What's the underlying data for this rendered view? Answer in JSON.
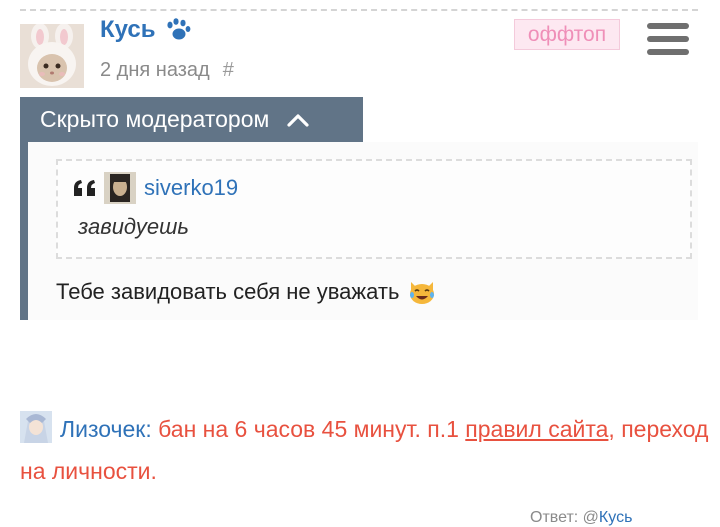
{
  "post": {
    "author": "Кусь",
    "timestamp": "2 дня назад",
    "permalink": "#",
    "tag": "оффтоп",
    "icons": {
      "author_badge": "paw-icon",
      "menu": "hamburger-menu-icon"
    }
  },
  "hidden_block": {
    "label": "Скрыто модератором",
    "toggle_icon": "chevron-up-icon",
    "bar_color": "#617487",
    "quote": {
      "author": "siverko19",
      "text": "завидуешь"
    },
    "reply_text": "Тебе завидовать себя не уважать",
    "emoji": "crying-laughing-cat-emoji"
  },
  "moderator_note": {
    "moderator": "Лизочек",
    "colon": ":",
    "ban_text": " бан на 6 часов 45 минут. п.1 ",
    "rules_link": "правил сайта",
    "reason": ", переход на личности."
  },
  "footer": {
    "reply_prefix": "Ответ: @",
    "reply_name": "Кусь"
  },
  "colors": {
    "link": "#2f72b8",
    "warning": "#e8513f",
    "tag_bg": "#fde8f1",
    "tag_text": "#ef8fb8"
  }
}
